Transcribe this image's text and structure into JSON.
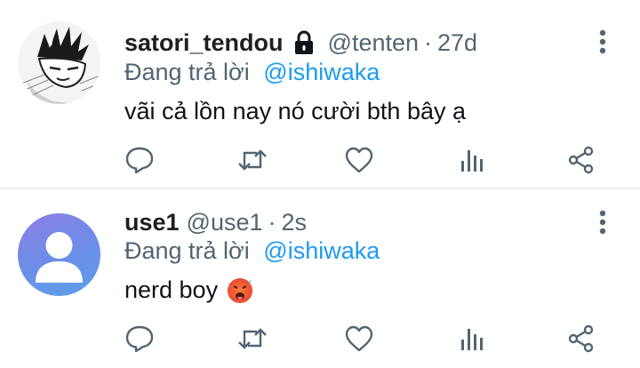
{
  "colors": {
    "text": "#0f1419",
    "secondary": "#536471",
    "mention": "#1d9bf0",
    "divider": "#e8ecef"
  },
  "tweets": [
    {
      "name": "satori_tendou",
      "verified_icon": "lock-icon",
      "handle": "@tenten",
      "separator": "·",
      "time": "27d",
      "reply_prefix": "Đang trả lời",
      "reply_to": "@ishiwaka",
      "text": "vãi cả lồn nay nó cười bth bây ạ",
      "avatar": "anime-sketch-avatar"
    },
    {
      "name": "use1",
      "handle": "@use1",
      "separator": "·",
      "time": "2s",
      "reply_prefix": "Đang trả lời",
      "reply_to": "@ishiwaka",
      "text": "nerd boy",
      "emoji": "hot-face-emoji",
      "avatar": "default-user-avatar"
    }
  ],
  "actions": [
    "reply-icon",
    "retweet-icon",
    "like-icon",
    "views-icon",
    "share-icon"
  ]
}
